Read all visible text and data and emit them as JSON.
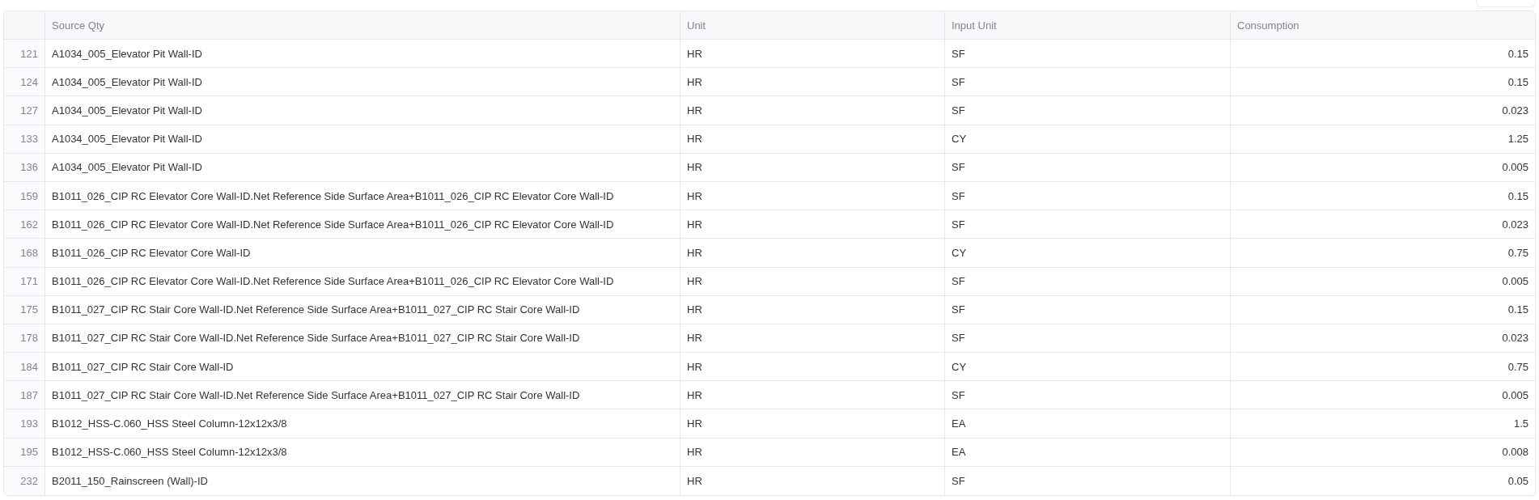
{
  "table": {
    "columns": [
      "Source Qty",
      "Unit",
      "Input Unit",
      "Consumption"
    ],
    "rows": [
      {
        "index": "121",
        "source_qty": "A1034_005_Elevator Pit Wall-ID",
        "unit": "HR",
        "input_unit": "SF",
        "consumption": "0.15"
      },
      {
        "index": "124",
        "source_qty": "A1034_005_Elevator Pit Wall-ID",
        "unit": "HR",
        "input_unit": "SF",
        "consumption": "0.15"
      },
      {
        "index": "127",
        "source_qty": "A1034_005_Elevator Pit Wall-ID",
        "unit": "HR",
        "input_unit": "SF",
        "consumption": "0.023"
      },
      {
        "index": "133",
        "source_qty": "A1034_005_Elevator Pit Wall-ID",
        "unit": "HR",
        "input_unit": "CY",
        "consumption": "1.25"
      },
      {
        "index": "136",
        "source_qty": "A1034_005_Elevator Pit Wall-ID",
        "unit": "HR",
        "input_unit": "SF",
        "consumption": "0.005"
      },
      {
        "index": "159",
        "source_qty": "B1011_026_CIP RC Elevator Core Wall-ID.Net Reference Side Surface Area+B1011_026_CIP RC Elevator Core Wall-ID",
        "unit": "HR",
        "input_unit": "SF",
        "consumption": "0.15"
      },
      {
        "index": "162",
        "source_qty": "B1011_026_CIP RC Elevator Core Wall-ID.Net Reference Side Surface Area+B1011_026_CIP RC Elevator Core Wall-ID",
        "unit": "HR",
        "input_unit": "SF",
        "consumption": "0.023"
      },
      {
        "index": "168",
        "source_qty": "B1011_026_CIP RC Elevator Core Wall-ID",
        "unit": "HR",
        "input_unit": "CY",
        "consumption": "0.75"
      },
      {
        "index": "171",
        "source_qty": "B1011_026_CIP RC Elevator Core Wall-ID.Net Reference Side Surface Area+B1011_026_CIP RC Elevator Core Wall-ID",
        "unit": "HR",
        "input_unit": "SF",
        "consumption": "0.005"
      },
      {
        "index": "175",
        "source_qty": "B1011_027_CIP RC Stair Core Wall-ID.Net Reference Side Surface Area+B1011_027_CIP RC Stair Core Wall-ID",
        "unit": "HR",
        "input_unit": "SF",
        "consumption": "0.15"
      },
      {
        "index": "178",
        "source_qty": "B1011_027_CIP RC Stair Core Wall-ID.Net Reference Side Surface Area+B1011_027_CIP RC Stair Core Wall-ID",
        "unit": "HR",
        "input_unit": "SF",
        "consumption": "0.023"
      },
      {
        "index": "184",
        "source_qty": "B1011_027_CIP RC Stair Core Wall-ID",
        "unit": "HR",
        "input_unit": "CY",
        "consumption": "0.75"
      },
      {
        "index": "187",
        "source_qty": "B1011_027_CIP RC Stair Core Wall-ID.Net Reference Side Surface Area+B1011_027_CIP RC Stair Core Wall-ID",
        "unit": "HR",
        "input_unit": "SF",
        "consumption": "0.005"
      },
      {
        "index": "193",
        "source_qty": "B1012_HSS-C.060_HSS Steel Column-12x12x3/8",
        "unit": "HR",
        "input_unit": "EA",
        "consumption": "1.5"
      },
      {
        "index": "195",
        "source_qty": "B1012_HSS-C.060_HSS Steel Column-12x12x3/8",
        "unit": "HR",
        "input_unit": "EA",
        "consumption": "0.008"
      },
      {
        "index": "232",
        "source_qty": "B2011_150_Rainscreen (Wall)-ID",
        "unit": "HR",
        "input_unit": "SF",
        "consumption": "0.05"
      }
    ]
  }
}
